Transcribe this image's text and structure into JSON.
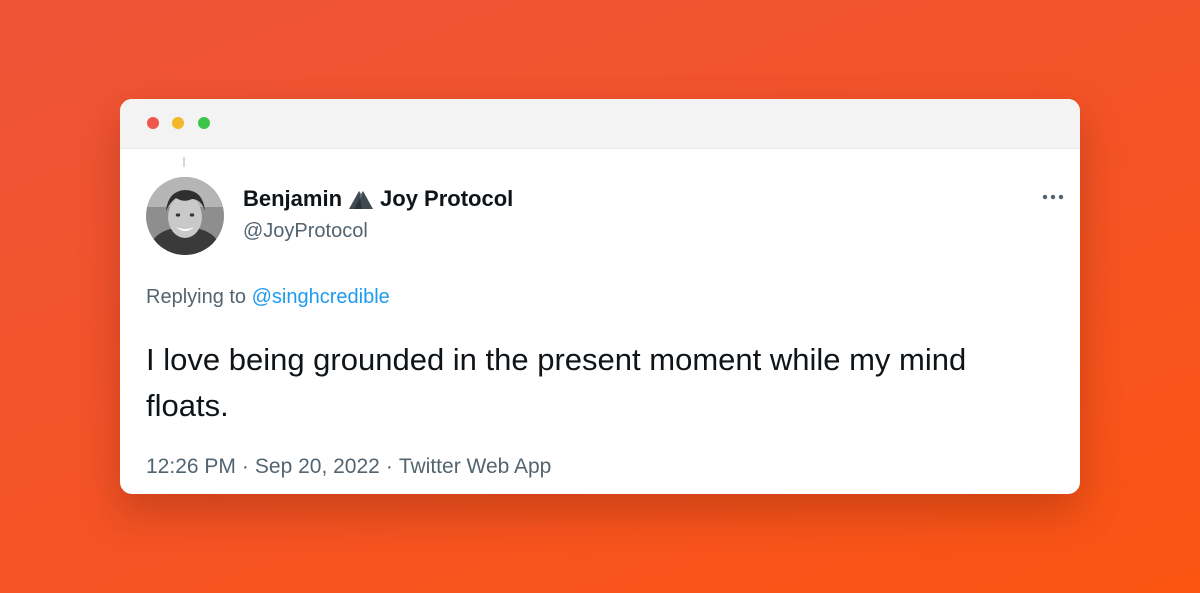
{
  "tweet": {
    "display_name_first": "Benjamin",
    "display_name_emoji_icon": "mountain-emoji-icon",
    "display_name_last": "Joy Protocol",
    "handle": "@JoyProtocol",
    "more_icon": "more-options-icon",
    "replying_to_label": "Replying to",
    "replying_to_mention": "@singhcredible",
    "text": "I love being grounded in the present moment while my mind floats.",
    "time": "12:26 PM",
    "date": "Sep 20, 2022",
    "source": "Twitter Web App",
    "separator": "·"
  },
  "colors": {
    "background_start": "#ee5438",
    "background_end": "#fb5412",
    "link": "#1d9bf0",
    "secondary_text": "#536471",
    "primary_text": "#0f1419"
  }
}
